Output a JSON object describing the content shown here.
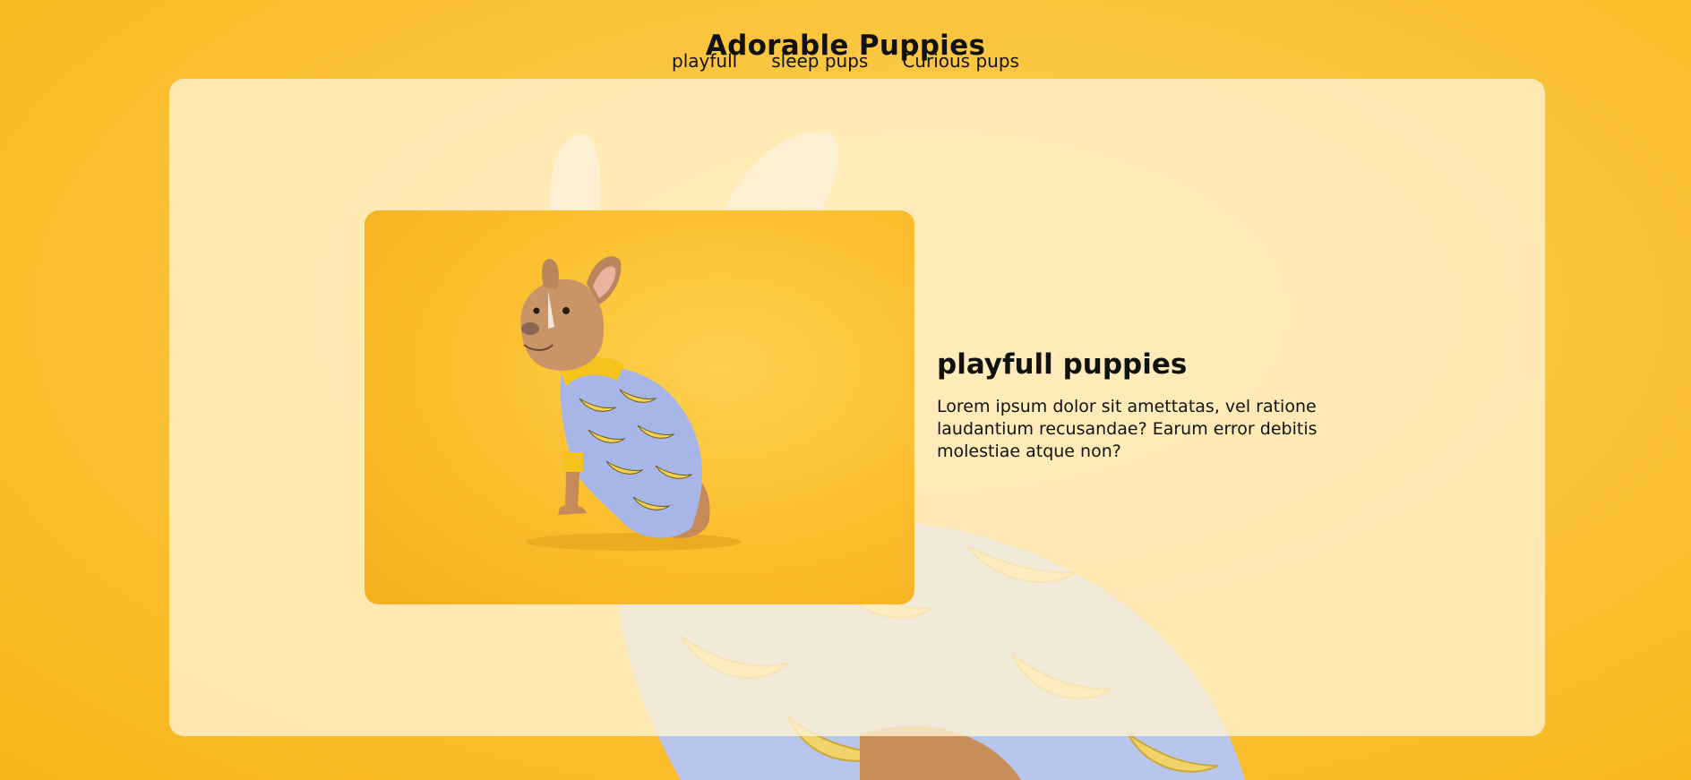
{
  "header": {
    "title": "Adorable Puppies",
    "nav": [
      "playfull",
      "sleep pups",
      "Curious pups"
    ]
  },
  "card": {
    "heading": "playfull puppies",
    "text": "Lorem ipsum dolor sit amettatas, vel ratione laudantium recusandae? Earum error debitis molestiae atque non?",
    "image": "french-bulldog-banana-shirt"
  },
  "colors": {
    "background": "#fcc43d",
    "panel": "#fff3d2",
    "shirt": "#a9b8e6",
    "banana": "#f6d356"
  }
}
